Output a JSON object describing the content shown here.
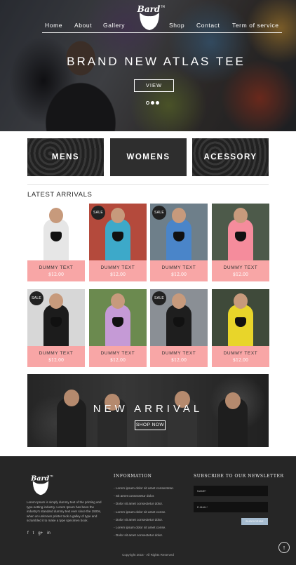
{
  "header": {
    "logo_text": "Bard",
    "logo_sup": "TM",
    "nav": [
      "Home",
      "About",
      "Gallery",
      "Shop",
      "Contact",
      "Term of service"
    ]
  },
  "hero": {
    "title": "BRAND NEW ATLAS TEE",
    "button": "VIEW",
    "slides_count": 3,
    "active_slide": 1
  },
  "categories": [
    "MENS",
    "WOMENS",
    "ACESSORY"
  ],
  "latest": {
    "title": "LATEST ARRIVALS",
    "products": [
      {
        "name": "DUMMY TEXT",
        "price": "$12.00",
        "sale": false,
        "sale_label": "",
        "shirt": "#e6e6e6",
        "bg": "#ffffff"
      },
      {
        "name": "DUMMY TEXT",
        "price": "$12.00",
        "sale": true,
        "sale_label": "SALE",
        "shirt": "#3da9c9",
        "bg": "#b44a3c"
      },
      {
        "name": "DUMMY TEXT",
        "price": "$12.00",
        "sale": true,
        "sale_label": "SALE",
        "shirt": "#4a85c9",
        "bg": "#6e7f8a"
      },
      {
        "name": "DUMMY TEXT",
        "price": "$12.00",
        "sale": false,
        "sale_label": "",
        "shirt": "#f58c9c",
        "bg": "#4d5a4a"
      },
      {
        "name": "DUMMY TEXT",
        "price": "$12.00",
        "sale": true,
        "sale_label": "SALE",
        "shirt": "#1c1c1c",
        "bg": "#d7d7d7"
      },
      {
        "name": "DUMMY TEXT",
        "price": "$12.00",
        "sale": false,
        "sale_label": "",
        "shirt": "#c59ad6",
        "bg": "#6b8a4f"
      },
      {
        "name": "DUMMY TEXT",
        "price": "$12.00",
        "sale": true,
        "sale_label": "SALE",
        "shirt": "#1e1e1e",
        "bg": "#8a8f95"
      },
      {
        "name": "DUMMY TEXT",
        "price": "$12.00",
        "sale": false,
        "sale_label": "",
        "shirt": "#e8d52a",
        "bg": "#3f4a3a"
      }
    ]
  },
  "banner": {
    "title": "NEW ARRIVAL",
    "button": "SHOP NOW"
  },
  "footer": {
    "about": "Lorem Ipsum is simply dummy text of the printing and type-setting industry. Lorem Ipsum has been the industry's standard dummy text ever since the 1500s, when an unknown printer took a galley of type and scrambled it to make a type specimen book.",
    "social": [
      "f",
      "t",
      "g+",
      "in"
    ],
    "info_title": "INFORMATION",
    "info_links": [
      "- Lorem ipsum dolor sit amet consectetur.",
      "- Sit amet consectetur dolor.",
      "- Dolor sit amet consectetur dolor.",
      "- Lorem ipsum dolor sit amet conse.",
      "- Dolor sit amet consectetur dolor.",
      "- Lorem ipsum dolor sit amet conse.",
      "- Dolor sit amet consectetur dolor."
    ],
    "newsletter_title": "SUBSCRIBE TO OUR NEWSLETTER",
    "name_placeholder": "NAME*",
    "email_placeholder": "E-MAIL*",
    "subscribe": "SUBSCRIBE",
    "copyright": "Copyright 2015 - All Rights Reserved",
    "back_to_top": "↑"
  },
  "colors": {
    "price_bar": "#f8a6a6",
    "footer_bg": "#262626",
    "subscribe_btn": "#a6bcd0"
  }
}
